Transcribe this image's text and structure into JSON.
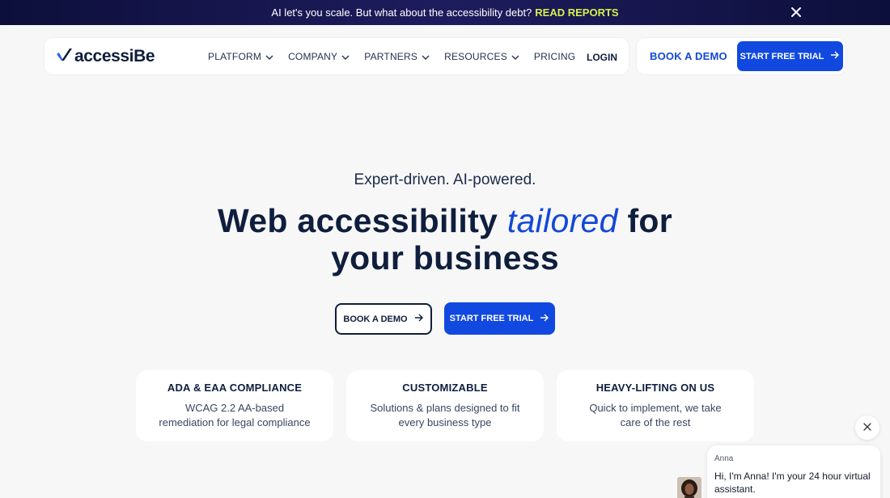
{
  "banner": {
    "text": "AI let's you scale. But what about the accessibility debt?",
    "link": "READ REPORTS"
  },
  "nav": {
    "logo": "accessiBe",
    "items": [
      {
        "label": "PLATFORM",
        "has_dropdown": true
      },
      {
        "label": "COMPANY",
        "has_dropdown": true
      },
      {
        "label": "PARTNERS",
        "has_dropdown": true
      },
      {
        "label": "RESOURCES",
        "has_dropdown": true
      },
      {
        "label": "PRICING",
        "has_dropdown": false
      }
    ],
    "login": "LOGIN",
    "book_demo": "BOOK A DEMO",
    "start_trial": "START FREE TRIAL"
  },
  "hero": {
    "eyebrow": "Expert-driven. AI-powered.",
    "headline_before": "Web accessibility",
    "headline_emphasis": "tailored",
    "headline_after": "for",
    "headline_line2": "your business",
    "book_demo": "BOOK A DEMO",
    "start_trial": "START FREE TRIAL"
  },
  "features": [
    {
      "title": "ADA & EAA COMPLIANCE",
      "desc": "WCAG 2.2 AA-based remediation for legal compliance"
    },
    {
      "title": "CUSTOMIZABLE",
      "desc": "Solutions & plans designed to fit every business type"
    },
    {
      "title": "HEAVY-LIFTING ON US",
      "desc": "Quick to implement, we take care of the rest"
    }
  ],
  "chat": {
    "name": "Anna",
    "message": "Hi, I'm Anna! I'm your 24 hour virtual assistant."
  },
  "colors": {
    "accent": "#1149e0",
    "navy": "#0f1e3c",
    "highlight": "#d7f04a",
    "banner": "#13134a"
  },
  "icons": {
    "banner_close": "close-icon",
    "dropdown": "chevron-down-icon",
    "button": "arrow-right-icon",
    "chat_close": "close-icon"
  }
}
